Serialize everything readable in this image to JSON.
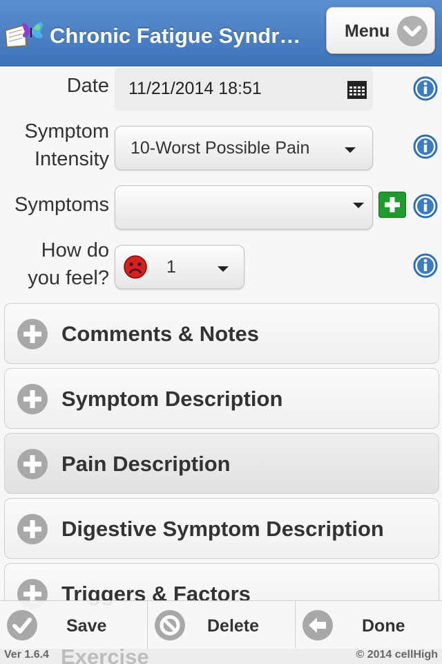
{
  "header": {
    "title": "Chronic Fatigue Syndr…",
    "menu_label": "Menu",
    "logo_icon": "butterfly-book-icon"
  },
  "form": {
    "date_label": "Date",
    "date_value": "11/21/2014 18:51",
    "intensity_label_line1": "Symptom",
    "intensity_label_line2": "Intensity",
    "intensity_value": "10-Worst Possible Pain",
    "symptoms_label": "Symptoms",
    "symptoms_value": "",
    "feel_label_line1": "How do",
    "feel_label_line2": "you feel?",
    "feel_value": "1",
    "feel_icon": "sad-face-icon"
  },
  "sections": [
    {
      "label": "Comments & Notes"
    },
    {
      "label": "Symptom Description"
    },
    {
      "label": "Pain Description"
    },
    {
      "label": "Digestive Symptom Description"
    },
    {
      "label": "Triggers & Factors"
    },
    {
      "label": "Exercise"
    }
  ],
  "toolbar": {
    "save_label": "Save",
    "delete_label": "Delete",
    "done_label": "Done"
  },
  "footer": {
    "version": "Ver 1.6.4",
    "copyright": "© 2014 cellHigh"
  },
  "colors": {
    "header": "#4a7fc1",
    "add_button": "#1e9a2e",
    "info_icon": "#2f6db5",
    "feel_face": "#d81e1e"
  }
}
